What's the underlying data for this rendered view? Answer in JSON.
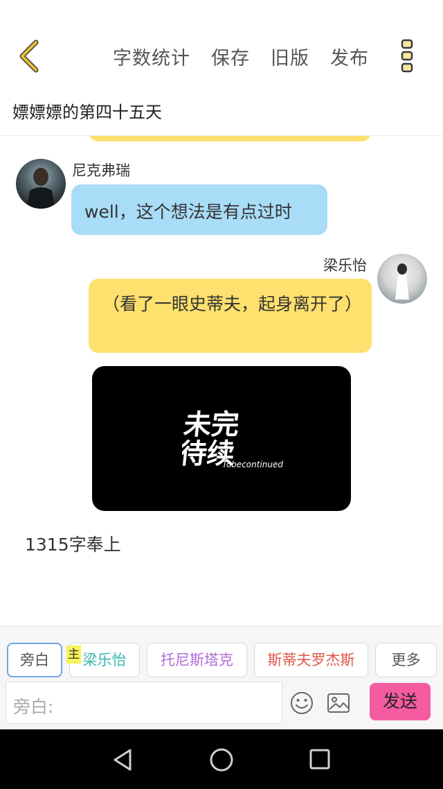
{
  "toolbar": {
    "word_stats": "字数统计",
    "save": "保存",
    "old_version": "旧版",
    "publish": "发布"
  },
  "document": {
    "title": "嫖嫖嫖的第四十五天"
  },
  "messages": [
    {
      "speaker": "尼克弗瑞",
      "side": "left",
      "text": "well，这个想法是有点过时",
      "color": "#a8dcf7"
    },
    {
      "speaker": "梁乐怡",
      "side": "right",
      "text": "（看了一眼史蒂夫，起身离开了）",
      "color": "#fde06d"
    }
  ],
  "image_card": {
    "logo_cn": "未完待续",
    "logo_en": "Tobecontinued"
  },
  "footer_note": "1315字奉上",
  "roles": {
    "narrator": "旁白",
    "liang": "梁乐怡",
    "liang_badge": "主",
    "tony": "托尼斯塔克",
    "steve": "斯蒂夫罗杰斯",
    "more": "更多"
  },
  "composer": {
    "placeholder": "旁白:",
    "send": "发送"
  },
  "colors": {
    "accent_yellow": "#fde06d",
    "bubble_blue": "#a8dcf7",
    "send_pink": "#f45ba0",
    "back_arrow": "#e6c23a"
  },
  "icons": [
    "chevron-left-icon",
    "more-vertical-icon",
    "emoji-icon",
    "image-icon",
    "nav-back-icon",
    "nav-home-icon",
    "nav-recent-icon"
  ]
}
